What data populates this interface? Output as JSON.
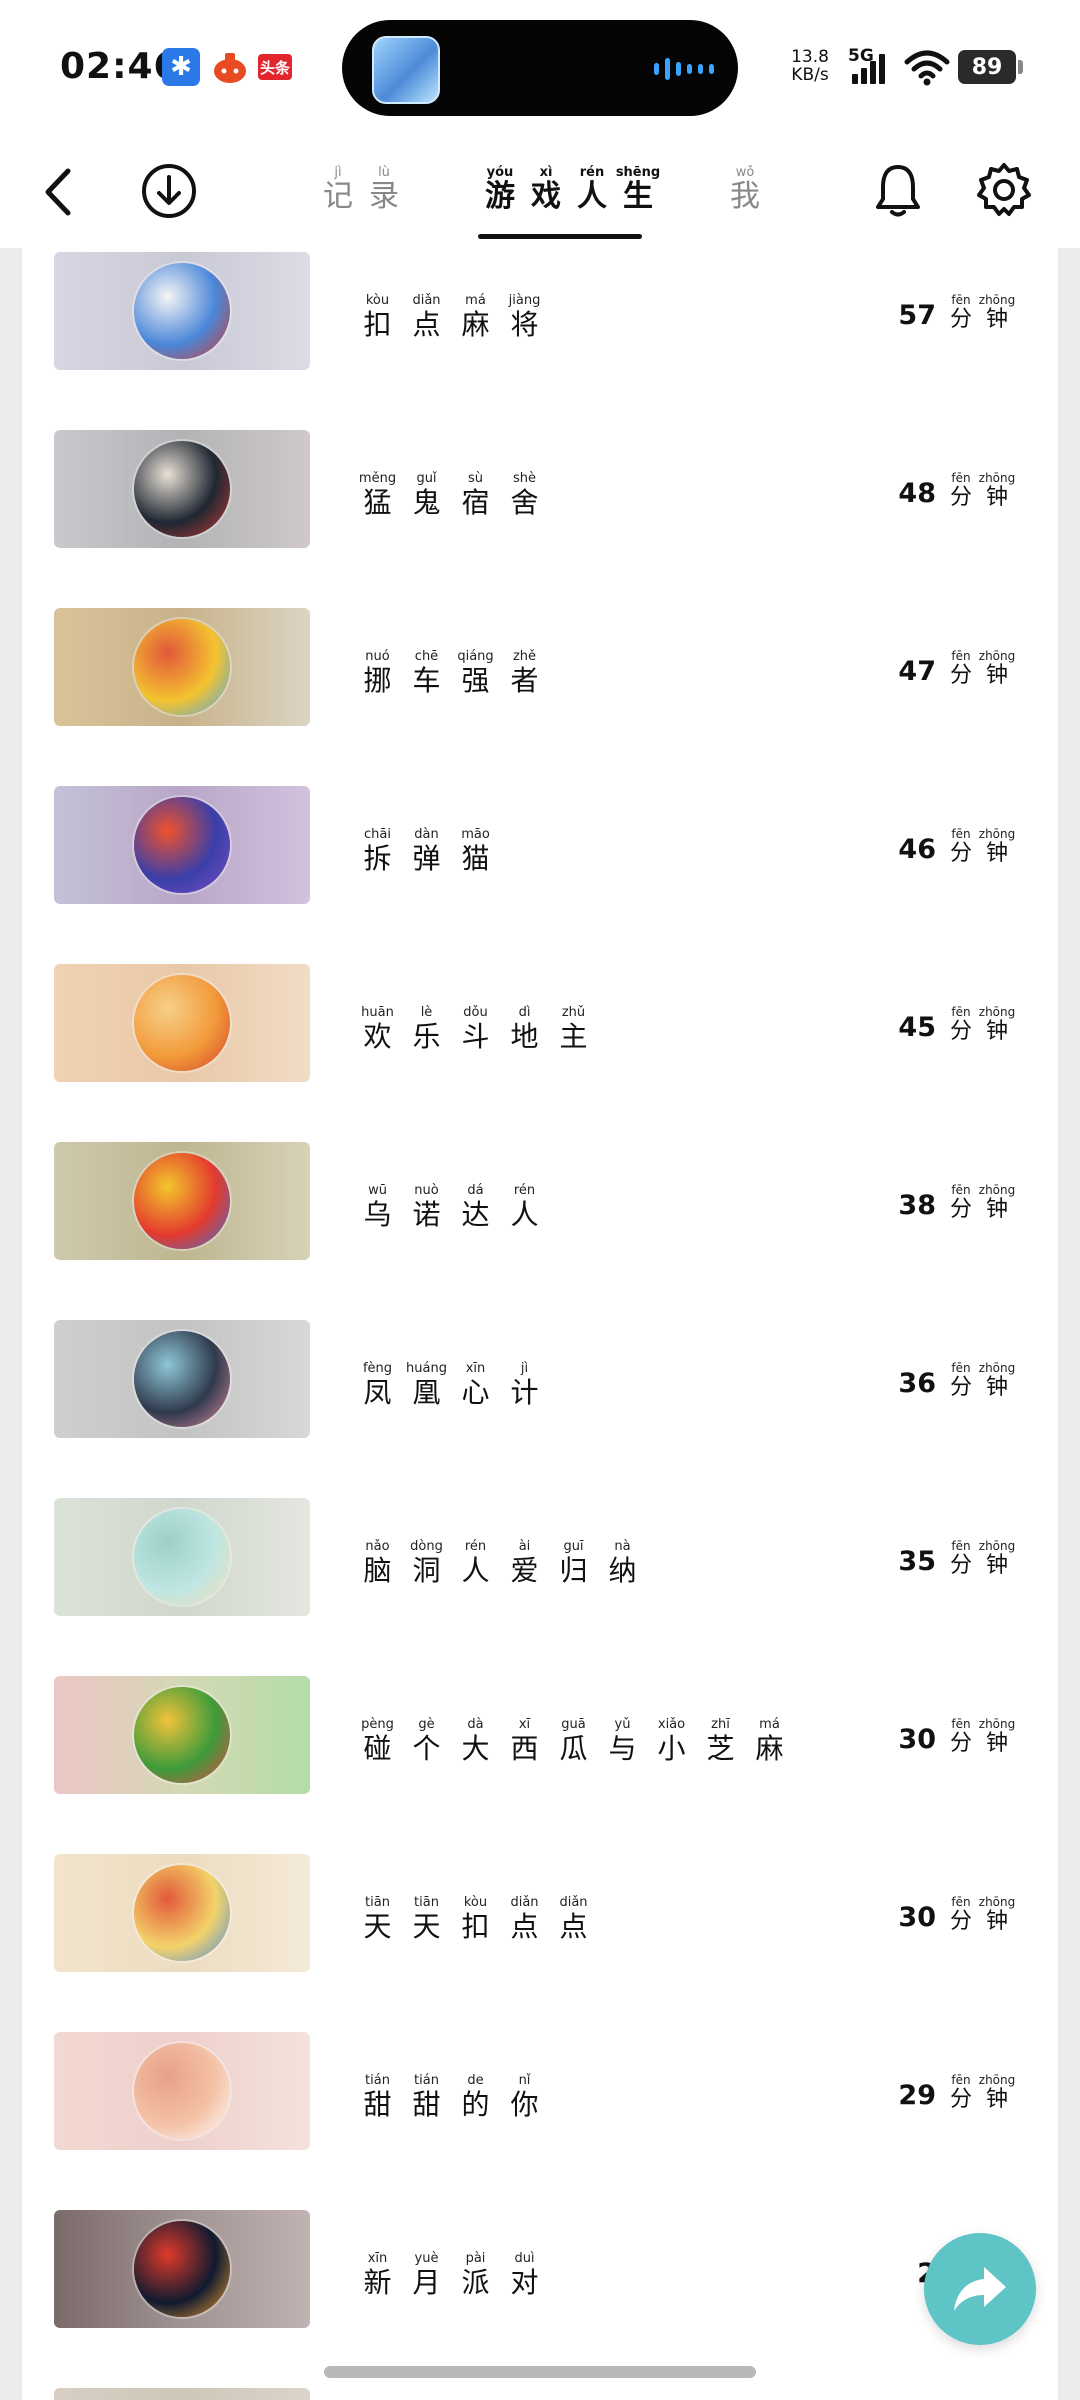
{
  "status_bar": {
    "time": "02:46",
    "bluetooth_glyph": "✱",
    "news_badge": "头条",
    "net_speed_value": "13.8",
    "net_speed_unit": "KB/s",
    "network": "5G",
    "battery": "89"
  },
  "header": {
    "tabs": [
      {
        "chars": [
          {
            "py": "jì",
            "hz": "记"
          },
          {
            "py": "lù",
            "hz": "录"
          }
        ]
      },
      {
        "chars": [
          {
            "py": "yóu",
            "hz": "游"
          },
          {
            "py": "xì",
            "hz": "戏"
          },
          {
            "py": "rén",
            "hz": "人"
          },
          {
            "py": "shēng",
            "hz": "生"
          }
        ]
      },
      {
        "chars": [
          {
            "py": "wǒ",
            "hz": "我"
          }
        ]
      }
    ]
  },
  "duration_unit": [
    {
      "py": "fēn",
      "hz": "分"
    },
    {
      "py": "zhōng",
      "hz": "钟"
    }
  ],
  "games": [
    {
      "name": [
        {
          "py": "kòu",
          "hz": "扣"
        },
        {
          "py": "diǎn",
          "hz": "点"
        },
        {
          "py": "má",
          "hz": "麻"
        },
        {
          "py": "jiàng",
          "hz": "将"
        }
      ],
      "minutes": "57",
      "colors": [
        "#d9d6e2",
        "#c9c9d6",
        "#dcdce6"
      ],
      "icon": [
        "#4a86d8",
        "#d53a2a",
        "#f5f5f5"
      ]
    },
    {
      "name": [
        {
          "py": "měng",
          "hz": "猛"
        },
        {
          "py": "guǐ",
          "hz": "鬼"
        },
        {
          "py": "sù",
          "hz": "宿"
        },
        {
          "py": "shè",
          "hz": "舍"
        }
      ],
      "minutes": "48",
      "colors": [
        "#c7c9cc",
        "#b3b3b6",
        "#cfc9c8"
      ],
      "icon": [
        "#1f2732",
        "#c53c34",
        "#e9e1d6"
      ]
    },
    {
      "name": [
        {
          "py": "nuó",
          "hz": "挪"
        },
        {
          "py": "chē",
          "hz": "车"
        },
        {
          "py": "qiáng",
          "hz": "强"
        },
        {
          "py": "zhě",
          "hz": "者"
        }
      ],
      "minutes": "47",
      "colors": [
        "#d9c49a",
        "#c8b28a",
        "#dbd5c4"
      ],
      "icon": [
        "#f4c330",
        "#46a6e8",
        "#e2573a"
      ]
    },
    {
      "name": [
        {
          "py": "chāi",
          "hz": "拆"
        },
        {
          "py": "dàn",
          "hz": "弹"
        },
        {
          "py": "māo",
          "hz": "猫"
        }
      ],
      "minutes": "46",
      "colors": [
        "#c4c2d8",
        "#b9a6c7",
        "#d2c2de"
      ],
      "icon": [
        "#3b3fa8",
        "#7b4fc6",
        "#f0512c"
      ]
    },
    {
      "name": [
        {
          "py": "huān",
          "hz": "欢"
        },
        {
          "py": "lè",
          "hz": "乐"
        },
        {
          "py": "dǒu",
          "hz": "斗"
        },
        {
          "py": "dì",
          "hz": "地"
        },
        {
          "py": "zhǔ",
          "hz": "主"
        }
      ],
      "minutes": "45",
      "colors": [
        "#f0d2b3",
        "#e8c8a8",
        "#f2dcc6"
      ],
      "icon": [
        "#f29a3a",
        "#d2412c",
        "#f7d08a"
      ]
    },
    {
      "name": [
        {
          "py": "wū",
          "hz": "乌"
        },
        {
          "py": "nuò",
          "hz": "诺"
        },
        {
          "py": "dá",
          "hz": "达"
        },
        {
          "py": "rén",
          "hz": "人"
        }
      ],
      "minutes": "38",
      "colors": [
        "#cfc9ad",
        "#beb690",
        "#d8d2b8"
      ],
      "icon": [
        "#e33a2e",
        "#3b72d2",
        "#f3c62c"
      ]
    },
    {
      "name": [
        {
          "py": "fèng",
          "hz": "凤"
        },
        {
          "py": "huáng",
          "hz": "凰"
        },
        {
          "py": "xīn",
          "hz": "心"
        },
        {
          "py": "jì",
          "hz": "计"
        }
      ],
      "minutes": "36",
      "colors": [
        "#cfcfcf",
        "#c3c3c3",
        "#d8d8d8"
      ],
      "icon": [
        "#2f3a4c",
        "#e28ca4",
        "#8fc7d8"
      ]
    },
    {
      "name": [
        {
          "py": "nǎo",
          "hz": "脑"
        },
        {
          "py": "dòng",
          "hz": "洞"
        },
        {
          "py": "rén",
          "hz": "人"
        },
        {
          "py": "ài",
          "hz": "爱"
        },
        {
          "py": "guī",
          "hz": "归"
        },
        {
          "py": "nà",
          "hz": "纳"
        }
      ],
      "minutes": "35",
      "colors": [
        "#dbe2d8",
        "#d0d8cd",
        "#e4e6df"
      ],
      "icon": [
        "#bfe6e2",
        "#f5e0b8",
        "#9dd0c8"
      ]
    },
    {
      "name": [
        {
          "py": "pèng",
          "hz": "碰"
        },
        {
          "py": "gè",
          "hz": "个"
        },
        {
          "py": "dà",
          "hz": "大"
        },
        {
          "py": "xī",
          "hz": "西"
        },
        {
          "py": "guā",
          "hz": "瓜"
        },
        {
          "py": "yǔ",
          "hz": "与"
        },
        {
          "py": "xiǎo",
          "hz": "小"
        },
        {
          "py": "zhī",
          "hz": "芝"
        },
        {
          "py": "má",
          "hz": "麻"
        }
      ],
      "minutes": "30",
      "colors": [
        "#ecc6c6",
        "#d4d8b4",
        "#b4dca8"
      ],
      "icon": [
        "#3e9b3a",
        "#e6464a",
        "#f2c23a"
      ]
    },
    {
      "name": [
        {
          "py": "tiān",
          "hz": "天"
        },
        {
          "py": "tiān",
          "hz": "天"
        },
        {
          "py": "kòu",
          "hz": "扣"
        },
        {
          "py": "diǎn",
          "hz": "点"
        },
        {
          "py": "diǎn",
          "hz": "点"
        }
      ],
      "minutes": "30",
      "colors": [
        "#f2e4cc",
        "#ecdcc0",
        "#f4ead8"
      ],
      "icon": [
        "#f3d36a",
        "#4a8ae0",
        "#e25a3a"
      ]
    },
    {
      "name": [
        {
          "py": "tián",
          "hz": "甜"
        },
        {
          "py": "tián",
          "hz": "甜"
        },
        {
          "py": "de",
          "hz": "的"
        },
        {
          "py": "nǐ",
          "hz": "你"
        }
      ],
      "minutes": "29",
      "colors": [
        "#f2d8d2",
        "#eed0cc",
        "#f4e2dc"
      ],
      "icon": [
        "#f4c2a6",
        "#ffffff",
        "#e8a088"
      ]
    },
    {
      "name": [
        {
          "py": "xīn",
          "hz": "新"
        },
        {
          "py": "yuè",
          "hz": "月"
        },
        {
          "py": "pài",
          "hz": "派"
        },
        {
          "py": "duì",
          "hz": "对"
        }
      ],
      "minutes": "2",
      "colors": [
        "#7a6a6a",
        "#a29393",
        "#c2b3b3"
      ],
      "icon": [
        "#101a30",
        "#f0a030",
        "#e03a2a"
      ]
    },
    {
      "name": [],
      "minutes": "",
      "colors": [
        "#d8cfc4",
        "#cfc6ba",
        "#dcd4c9"
      ],
      "icon": [
        "#d8cfc4",
        "#d8cfc4",
        "#d8cfc4"
      ]
    }
  ]
}
